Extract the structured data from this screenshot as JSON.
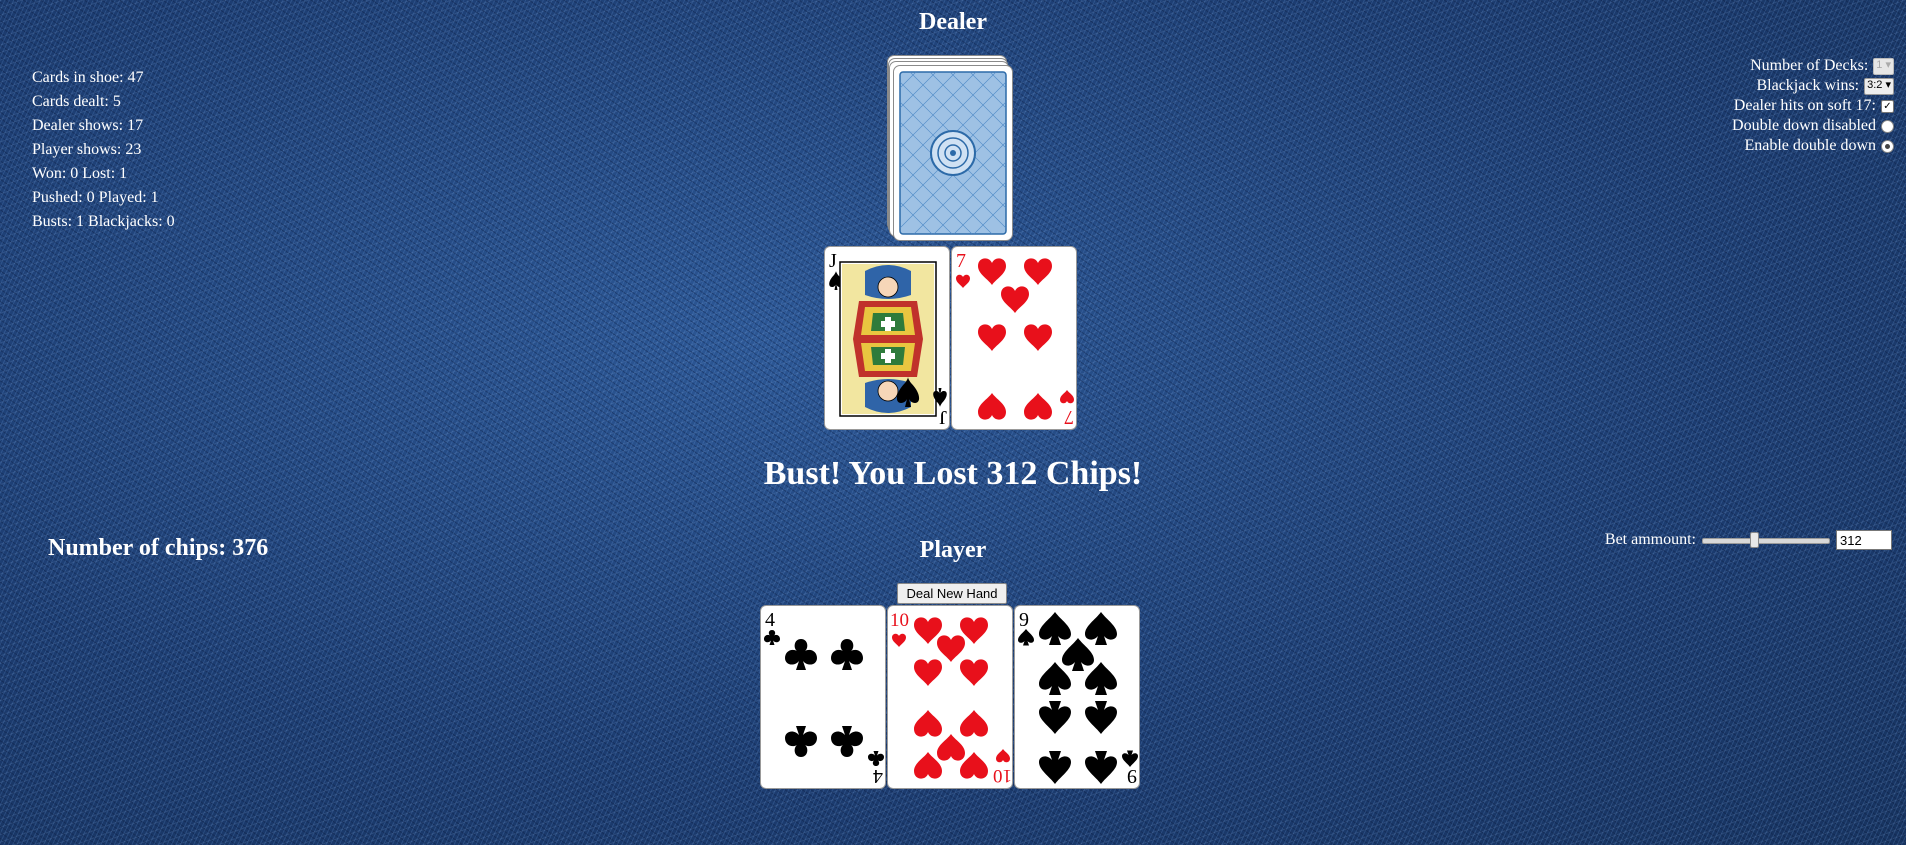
{
  "dealer": {
    "title": "Dealer"
  },
  "player": {
    "title": "Player"
  },
  "stats": {
    "cards_in_shoe": "Cards in shoe: 47",
    "cards_dealt": "Cards dealt: 5",
    "dealer_shows": "Dealer shows: 17",
    "player_shows": "Player shows: 23",
    "won_lost": "Won: 0 Lost: 1",
    "pushed_played": "Pushed: 0 Played: 1",
    "busts_blackjacks": "Busts: 1 Blackjacks: 0"
  },
  "settings": {
    "decks_label": "Number of Decks:",
    "decks_value": "1",
    "blackjack_label": "Blackjack wins:",
    "blackjack_value": "3:2",
    "soft17_label": "Dealer hits on soft 17:",
    "soft17_checked": true,
    "double_disabled_label": "Double down disabled",
    "double_enabled_label": "Enable double down",
    "double_down_selected": "enable"
  },
  "message": "Bust! You Lost 312 Chips!",
  "chips": "Number of chips: 376",
  "bet": {
    "label": "Bet ammount:",
    "value": "312",
    "slider_fraction": 0.4
  },
  "deal_button": "Deal New Hand",
  "dealer_cards": [
    {
      "rank": "J",
      "suit": "spades",
      "color": "#000000"
    },
    {
      "rank": "7",
      "suit": "hearts",
      "color": "#e8101b"
    }
  ],
  "player_cards": [
    {
      "rank": "4",
      "suit": "clubs",
      "color": "#000000"
    },
    {
      "rank": "10",
      "suit": "hearts",
      "color": "#e8101b"
    },
    {
      "rank": "9",
      "suit": "spades",
      "color": "#000000"
    }
  ],
  "colors": {
    "table": "#1d3f73",
    "red_suit": "#e8101b",
    "card_back": "#3b78b8"
  }
}
